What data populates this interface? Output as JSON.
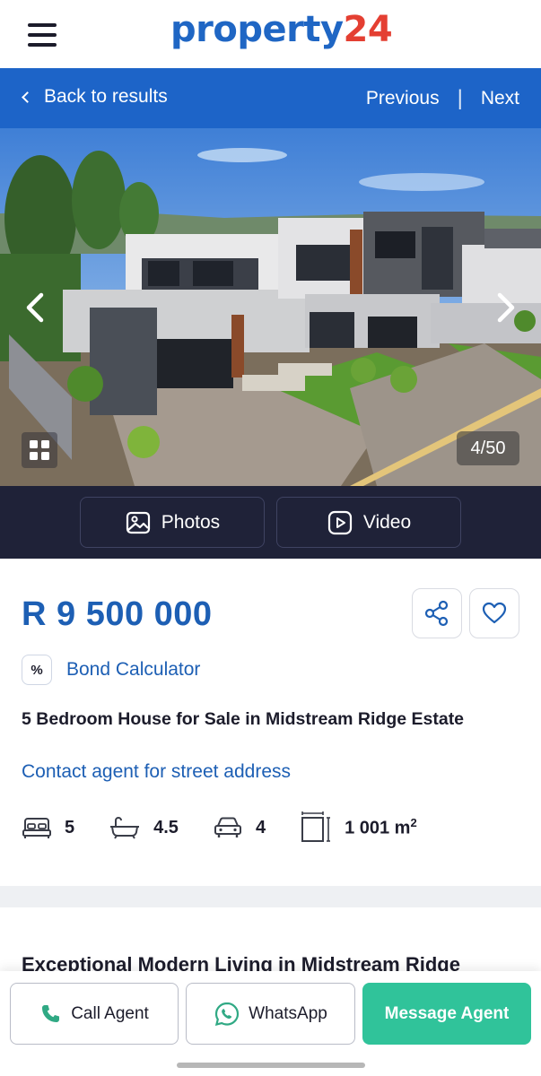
{
  "header": {
    "logo_text_1": "property",
    "logo_text_2": "24",
    "brand_color": "#1f66c4",
    "accent_color": "#e43f32"
  },
  "nav": {
    "back_label": "Back to results",
    "previous_label": "Previous",
    "separator": "|",
    "next_label": "Next"
  },
  "gallery": {
    "counter": "4/50",
    "photos_label": "Photos",
    "video_label": "Video"
  },
  "listing": {
    "price": "R 9 500 000",
    "bond_icon": "%",
    "bond_label": "Bond Calculator",
    "title": "5 Bedroom House for Sale in Midstream Ridge Estate",
    "address_label": "Contact agent for street address",
    "features": {
      "bedrooms": "5",
      "bathrooms": "4.5",
      "garages": "4",
      "erf_size": "1 001 m",
      "erf_unit_sup": "2"
    },
    "description_title": "Exceptional Modern Living in Midstream Ridge"
  },
  "actions": {
    "call_label": "Call Agent",
    "whatsapp_label": "WhatsApp",
    "message_label": "Message Agent",
    "message_color": "#30c39a"
  }
}
